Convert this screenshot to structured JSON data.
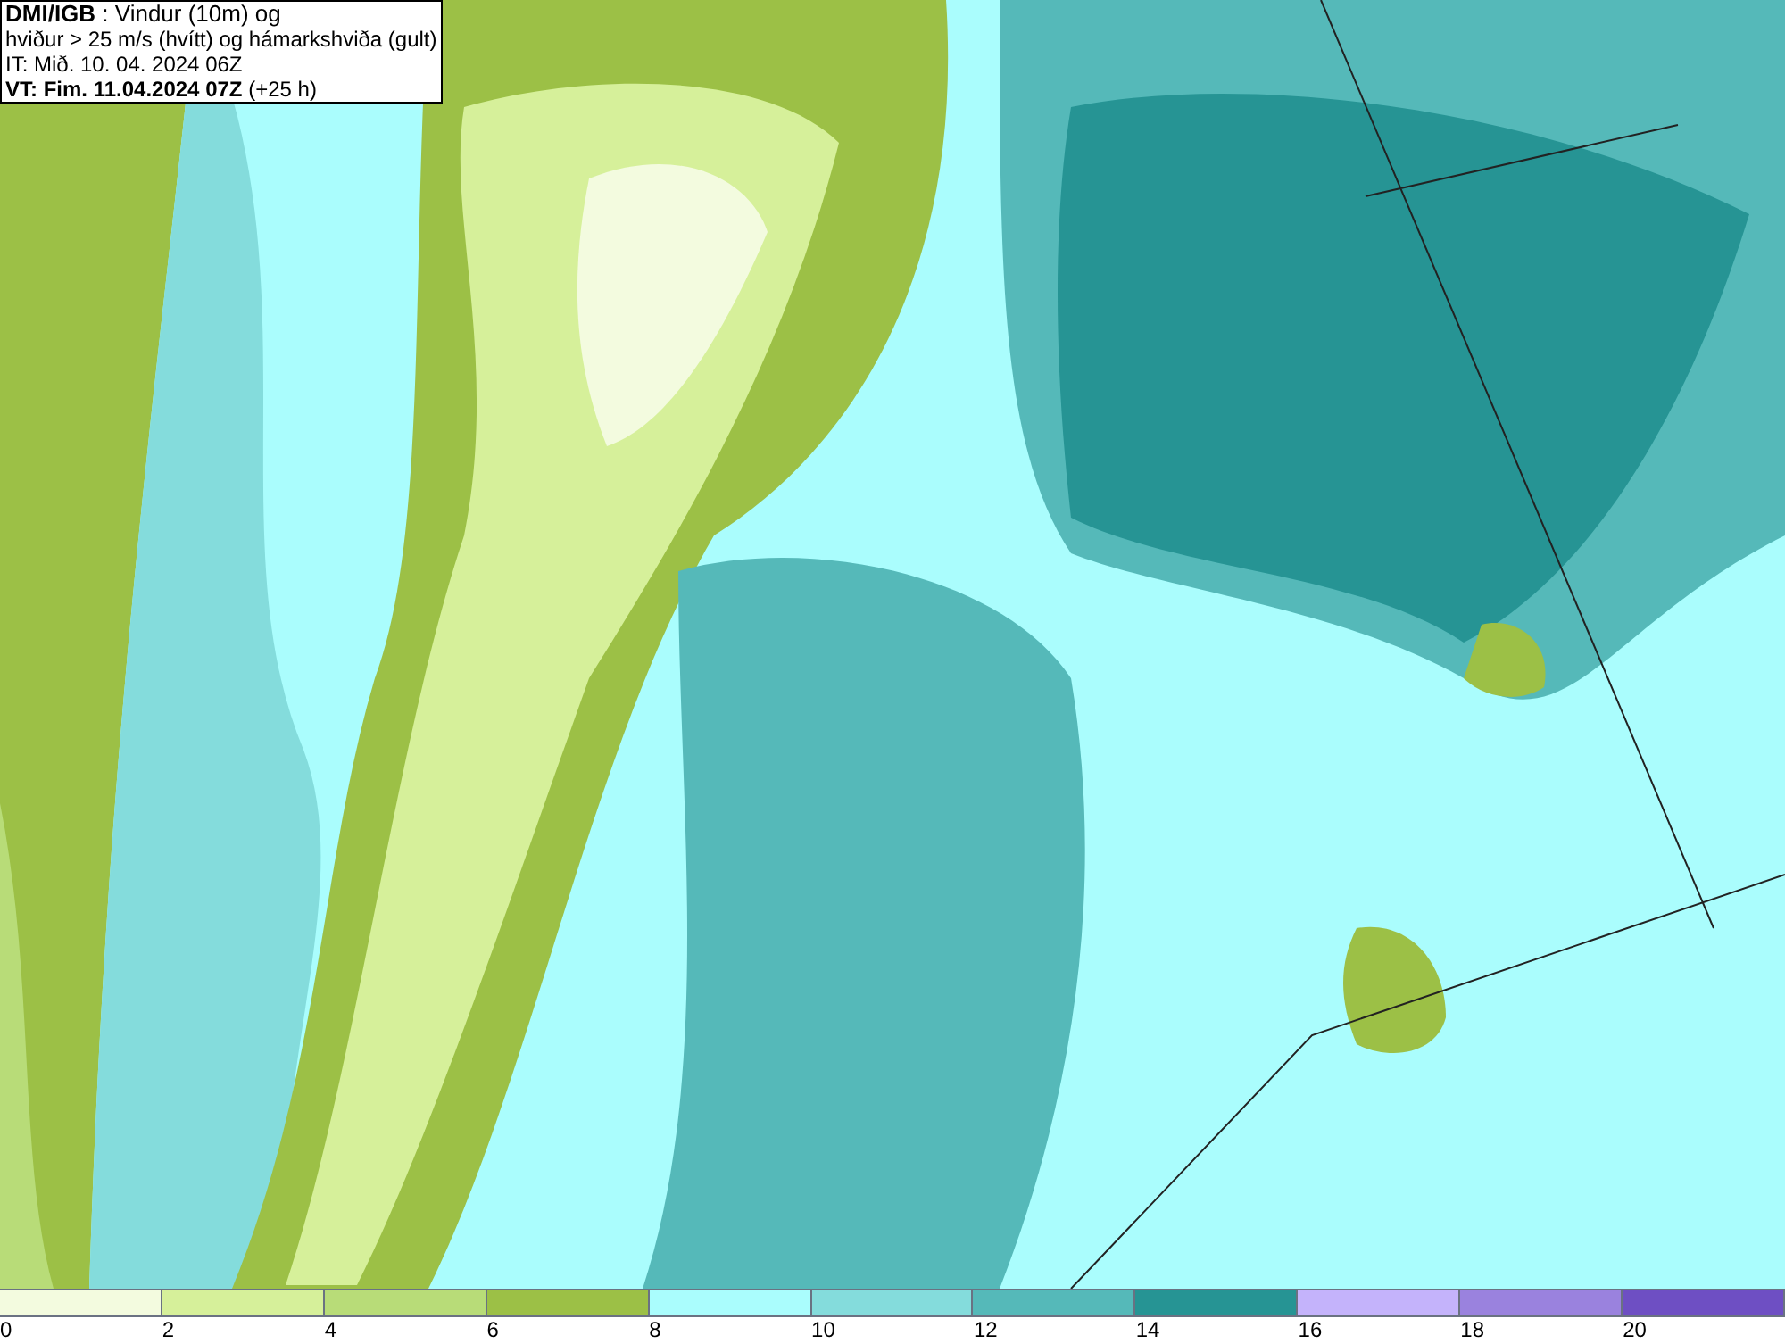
{
  "header": {
    "lines": [
      "**DMI/IGB** : Vindur (10m) og",
      "hviður > 25 m/s (hvítt) og hámarkshviða (gult)",
      "IT: Mið. 10. 04. 2024 06Z",
      "**VT: Fim. 11.04.2024 07Z** (+25 h)"
    ]
  },
  "colorbar": {
    "segments": [
      {
        "color": "#f3fbdf"
      },
      {
        "color": "#d6f09a"
      },
      {
        "color": "#b8dc78"
      },
      {
        "color": "#9cc046"
      },
      {
        "color": "#aafdfd"
      },
      {
        "color": "#84dcdc"
      },
      {
        "color": "#55b9b9"
      },
      {
        "color": "#269494"
      },
      {
        "color": "#c4b3fb"
      },
      {
        "color": "#9a82de"
      },
      {
        "color": "#6e4fc3"
      }
    ],
    "ticks": [
      "0",
      "2",
      "4",
      "6",
      "8",
      "10",
      "12",
      "14",
      "16",
      "18",
      "20"
    ]
  }
}
